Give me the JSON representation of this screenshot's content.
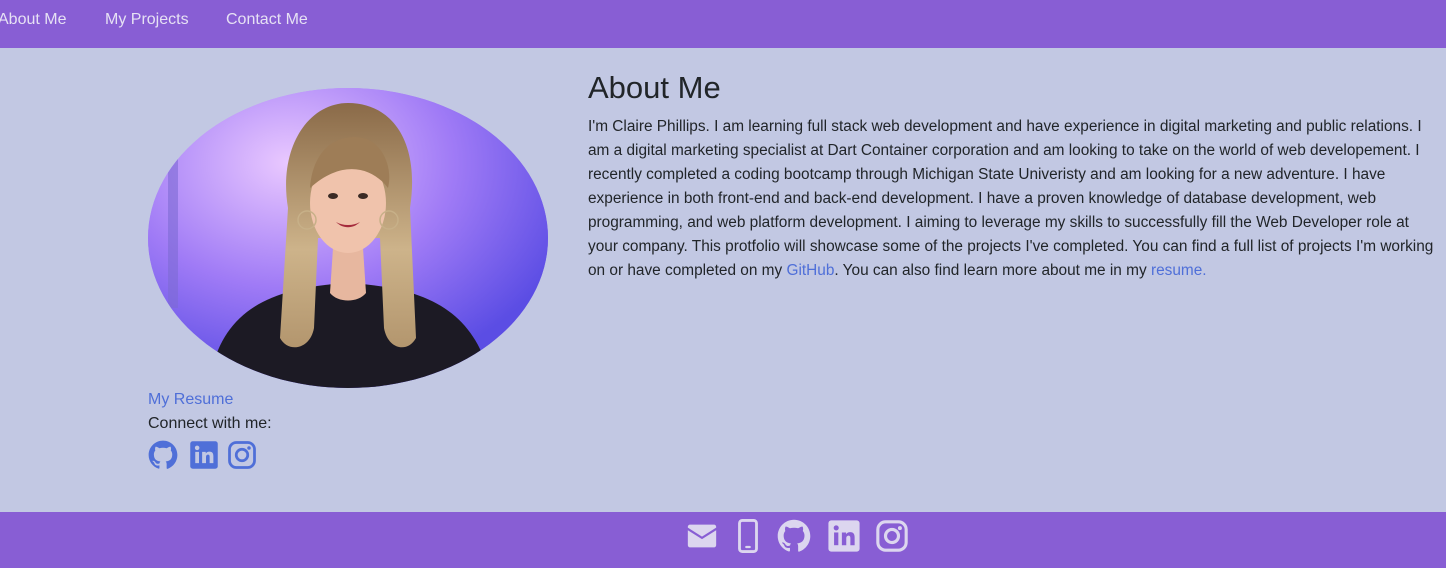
{
  "nav": {
    "items": [
      {
        "label": "About Me"
      },
      {
        "label": "My Projects"
      },
      {
        "label": "Contact Me"
      }
    ]
  },
  "sidebar": {
    "photo_icon": "profile-photo",
    "resume_link": "My Resume",
    "connect_label": "Connect with me:",
    "social_icons": [
      "github-icon",
      "linkedin-icon",
      "instagram-icon"
    ]
  },
  "about": {
    "title": "About Me",
    "bio_text": "I'm Claire Phillips. I am learning full stack web development and have experience in digital marketing and public relations. I am a digital marketing specialist at Dart Container corporation and am looking to take on the world of web developement. I recently completed a coding bootcamp through Michigan State Univeristy and am looking for a new adventure. I have experience in both front-end and back-end development. I have a proven knowledge of database development, web programming, and web platform development. I aiming to leverage my skills to successfully fill the Web Developer role at your company. This protfolio will showcase some of the projects I've completed. You can find a full list of projects I'm working on or have completed on my ",
    "github_link": "GitHub",
    "bio_text_2": ". You can also find learn more about me in my ",
    "resume_link": "resume."
  },
  "footer": {
    "icons": [
      "envelope-icon",
      "phone-icon",
      "github-icon",
      "linkedin-icon",
      "instagram-icon"
    ]
  },
  "colors": {
    "nav_bg": "#885ed4",
    "page_bg": "#c2c8e3",
    "link": "#4f6fd8",
    "footer_icon": "#dcd6ef"
  }
}
